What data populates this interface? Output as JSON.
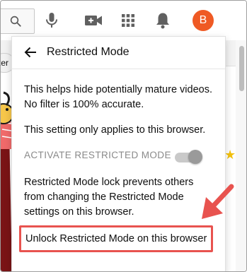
{
  "header": {
    "avatar_letter": "B",
    "avatar_color": "#ef5a24"
  },
  "background": {
    "chip_text": "ter"
  },
  "panel": {
    "title": "Restricted Mode",
    "description": "This helps hide potentially mature videos. No filter is 100% accurate.",
    "browser_note": "This setting only applies to this browser.",
    "activate_label": "ACTIVATE RESTRICTED MODE",
    "activate_enabled": false,
    "lock_text": "Restricted Mode lock prevents others from changing the Restricted Mode settings on this browser.",
    "unlock_link": "Unlock Restricted Mode on this browser"
  },
  "colors": {
    "highlight": "#e8534f",
    "accent_star": "#f4c20d"
  }
}
